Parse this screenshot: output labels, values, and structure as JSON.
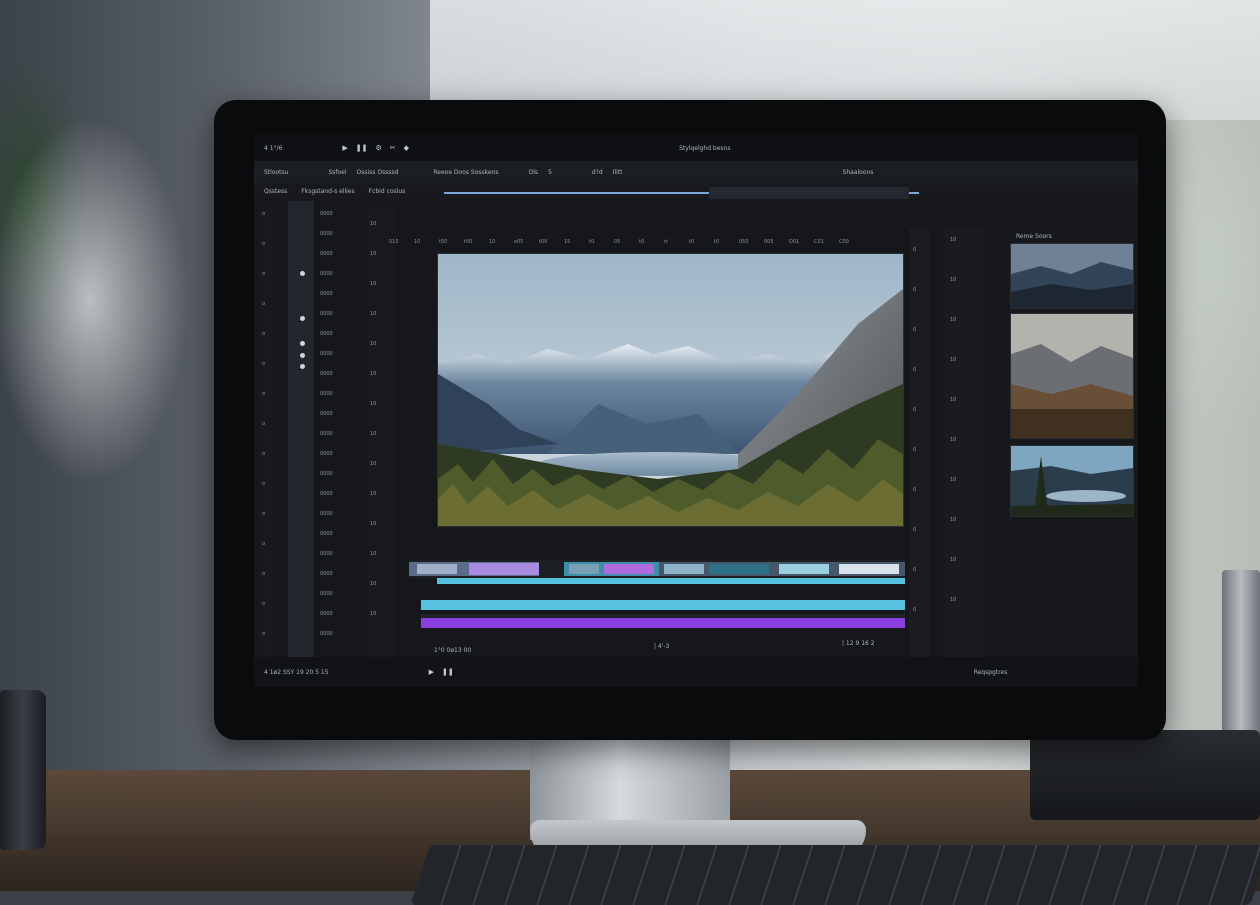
{
  "topbar": {
    "left_text": "4 1°/6",
    "center_title": "Stylqelghd besns"
  },
  "menubar": {
    "items": [
      "Stlootsu",
      "Ssfoel",
      "Ossiss Ossssd",
      "Reeoe  Doos Sosskens",
      "Ols",
      "5",
      "d?d",
      "Ilitt",
      "Shaaloons"
    ]
  },
  "subbar": {
    "items": [
      "Qsstess",
      "Fksgstand-s ellies",
      "Fcbid coslus"
    ]
  },
  "ruler": {
    "ticks": [
      "510",
      "10",
      "t50",
      "t00",
      "10",
      "e05",
      "t09",
      "15",
      "t0",
      "05",
      "t0",
      "rt",
      "t0",
      "t0",
      "050",
      "005",
      "D01",
      "C01",
      "C00"
    ]
  },
  "timeline": {
    "timecode_left": "1°0 0ø13 00",
    "timecode_mid": "| 4'-3",
    "timecode_right": "| 12 9  16 2"
  },
  "right_panel": {
    "title": "Reme Soors",
    "footer": "Reqspgtres"
  },
  "bottombar": {
    "left_text": "4  1ø2  SSY  19  20 5 15",
    "right_text": "Reqspgtres"
  },
  "colors": {
    "accent": "#7aa6d8",
    "clip_teal": "#57c2df",
    "clip_purple": "#8a3fe0"
  },
  "icons": [
    "play-icon",
    "pause-icon",
    "gear-icon",
    "scissors-icon",
    "marker-icon"
  ]
}
